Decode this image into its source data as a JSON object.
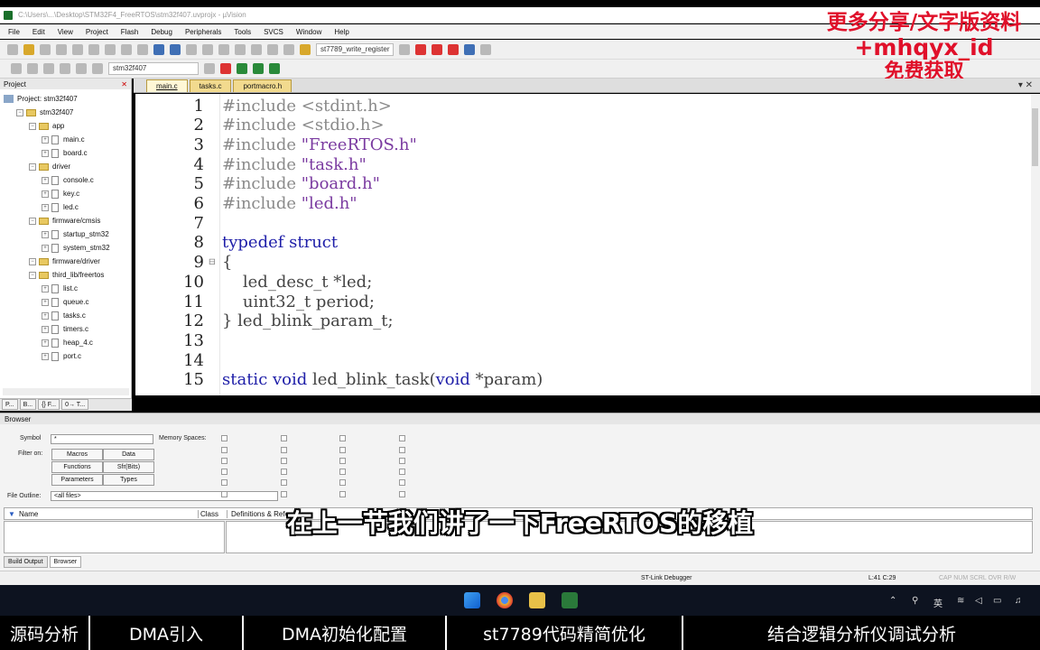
{
  "window": {
    "title": "C:\\Users\\...\\Desktop\\STM32F4_FreeRTOS\\stm32f407.uvprojx - µVision"
  },
  "menu": [
    "File",
    "Edit",
    "View",
    "Project",
    "Flash",
    "Debug",
    "Peripherals",
    "Tools",
    "SVCS",
    "Window",
    "Help"
  ],
  "toolbar": {
    "target_combo": "st7789_write_register"
  },
  "toolbar2": {
    "target_combo": "stm32f407"
  },
  "promo": {
    "line1": "更多分享/文字版资料",
    "line2": "+mhqyx_id",
    "line3": "免费获取"
  },
  "project": {
    "header": "Project",
    "tree": [
      {
        "label": "Project: stm32f407",
        "type": "project",
        "level": 0
      },
      {
        "label": "stm32f407",
        "type": "folder",
        "level": 1
      },
      {
        "label": "app",
        "type": "folder",
        "level": 2
      },
      {
        "label": "main.c",
        "type": "file",
        "level": 3
      },
      {
        "label": "board.c",
        "type": "file",
        "level": 3
      },
      {
        "label": "driver",
        "type": "folder",
        "level": 2
      },
      {
        "label": "console.c",
        "type": "file",
        "level": 3
      },
      {
        "label": "key.c",
        "type": "file",
        "level": 3
      },
      {
        "label": "led.c",
        "type": "file",
        "level": 3
      },
      {
        "label": "firmware/cmsis",
        "type": "folder",
        "level": 2
      },
      {
        "label": "startup_stm32",
        "type": "file",
        "level": 3
      },
      {
        "label": "system_stm32",
        "type": "file",
        "level": 3
      },
      {
        "label": "firmware/driver",
        "type": "folder",
        "level": 2
      },
      {
        "label": "third_lib/freertos",
        "type": "folder",
        "level": 2
      },
      {
        "label": "list.c",
        "type": "file",
        "level": 3
      },
      {
        "label": "queue.c",
        "type": "file",
        "level": 3
      },
      {
        "label": "tasks.c",
        "type": "file",
        "level": 3
      },
      {
        "label": "timers.c",
        "type": "file",
        "level": 3
      },
      {
        "label": "heap_4.c",
        "type": "file",
        "level": 3
      },
      {
        "label": "port.c",
        "type": "file",
        "level": 3
      }
    ],
    "tabs": [
      "P...",
      "B...",
      "{} F...",
      "0→ T..."
    ]
  },
  "editor": {
    "tabs": [
      {
        "label": "main.c",
        "active": true
      },
      {
        "label": "tasks.c",
        "active": false
      },
      {
        "label": "portmacro.h",
        "active": false
      }
    ],
    "lines": [
      {
        "n": "1",
        "html": "<span class='pp'>#include</span> <span class='pp'>&lt;stdint.h&gt;</span>"
      },
      {
        "n": "2",
        "html": "<span class='pp'>#include</span> <span class='pp'>&lt;stdio.h&gt;</span>"
      },
      {
        "n": "3",
        "html": "<span class='pp'>#include</span> <span class='st'>\"FreeRTOS.h\"</span>"
      },
      {
        "n": "4",
        "html": "<span class='pp'>#include</span> <span class='st'>\"task.h\"</span>"
      },
      {
        "n": "5",
        "html": "<span class='pp'>#include</span> <span class='st'>\"board.h\"</span>"
      },
      {
        "n": "6",
        "html": "<span class='pp'>#include</span> <span class='st'>\"led.h\"</span>"
      },
      {
        "n": "7",
        "html": ""
      },
      {
        "n": "8",
        "html": "<span class='kw'>typedef struct</span>"
      },
      {
        "n": "9",
        "html": "{",
        "fold": true
      },
      {
        "n": "10",
        "html": "    led_desc_t *led;"
      },
      {
        "n": "11",
        "html": "    uint32_t period;"
      },
      {
        "n": "12",
        "html": "} led_blink_param_t;"
      },
      {
        "n": "13",
        "html": ""
      },
      {
        "n": "14",
        "html": ""
      },
      {
        "n": "15",
        "html": "<span class='kw'>static void</span> led_blink_task(<span class='kw'>void</span> *param)"
      }
    ]
  },
  "browser": {
    "header": "Browser",
    "symbol_label": "Symbol",
    "symbol_value": "*",
    "filter_label": "Filter on:",
    "memory_label": "Memory Spaces:",
    "filters": [
      "Macros",
      "Data",
      "Functions",
      "Sfr(Bits)",
      "Parameters",
      "Types"
    ],
    "outline_label": "File Outline:",
    "outline_value": "<all files>",
    "columns": [
      "Name",
      "Class",
      "Definitions & References"
    ],
    "tabs": [
      "Build Output",
      "Browser"
    ]
  },
  "status": {
    "debugger": "ST-Link Debugger",
    "position": "L:41 C:29",
    "caps": "CAP NUM SCRL OVR R/W"
  },
  "subtitle": "在上一节我们讲了一下FreeRTOS的移植",
  "chapters": [
    "源码分析",
    "DMA引入",
    "DMA初始化配置",
    "st7789代码精简优化",
    "结合逻辑分析仪调试分析"
  ],
  "tray": {
    "lang": "英"
  },
  "colors": {
    "promo": "#e0102a",
    "keyword": "#1e1ea8",
    "string": "#7a3aa0"
  }
}
